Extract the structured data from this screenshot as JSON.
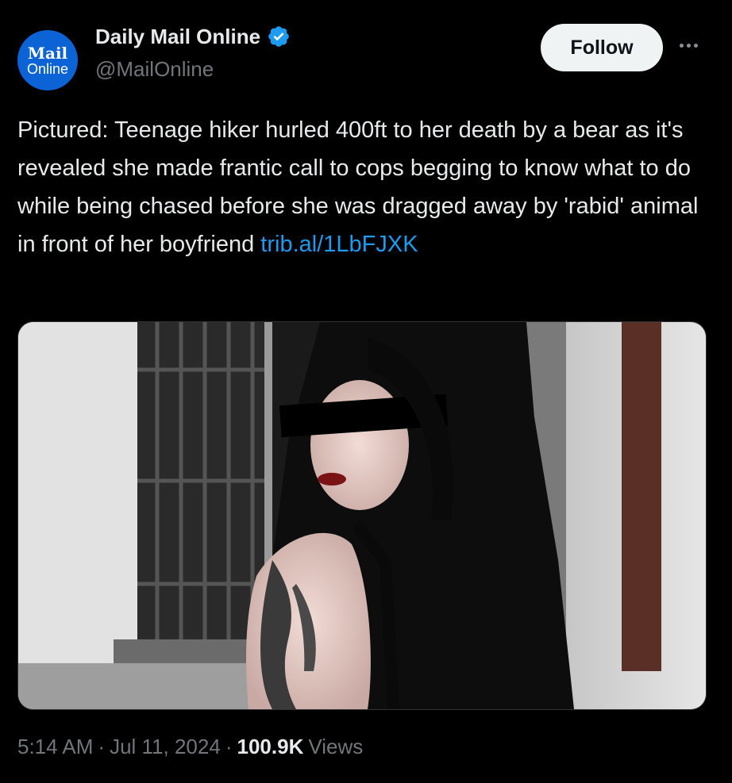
{
  "author": {
    "avatar_text_top": "Mail",
    "avatar_text_bottom": "Online",
    "display_name": "Daily Mail Online",
    "handle": "@MailOnline",
    "verified": true
  },
  "actions": {
    "follow_label": "Follow",
    "more_icon": "more-horizontal-icon"
  },
  "tweet": {
    "text": "Pictured: Teenage hiker hurled 400ft to her death by a bear as it's revealed she made frantic call to cops begging to know what to do while being chased before she was dragged away by 'rabid' animal in front of her boyfriend ",
    "link": "trib.al/1LbFJXK"
  },
  "meta": {
    "time": "5:14 AM",
    "sep1": "·",
    "date": "Jul 11, 2024",
    "sep2": "·",
    "views_count": "100.9K",
    "views_label": "Views"
  },
  "colors": {
    "background": "#000000",
    "text": "#e7e9ea",
    "secondary": "#71767b",
    "link": "#1d9bf0",
    "verified": "#1d9bf0",
    "avatar": "#0b63d6"
  }
}
